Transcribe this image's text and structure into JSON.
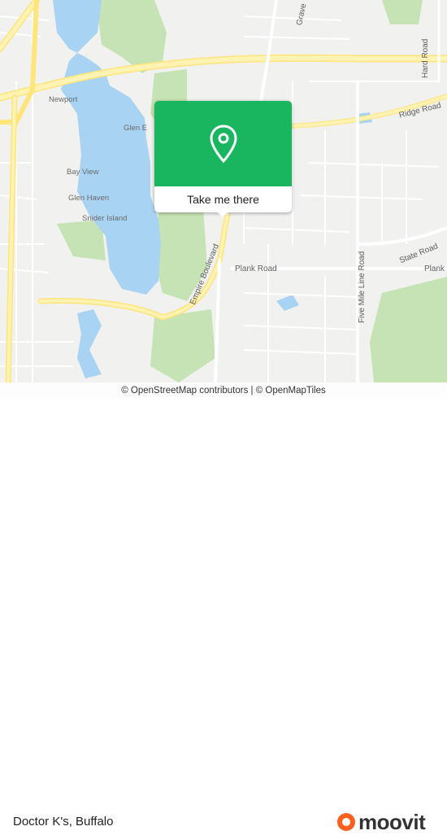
{
  "map": {
    "roads": {
      "hard_road": "Hard Road",
      "ridge_road": "Ridge Road",
      "state_road": "State Road",
      "plank_road": "Plank Road",
      "empire_boulevard": "Empire Boulevard",
      "five_mile_line_road": "Five Mile Line Road",
      "grave": "Grave"
    },
    "places": {
      "newport": "Newport",
      "glen_e": "Glen E",
      "bay_view": "Bay View",
      "glen_haven": "Glen Haven",
      "snider_island": "Snider Island"
    },
    "colors": {
      "water": "#a9d3f2",
      "park": "#c5e3b4",
      "land": "#f1f1ef",
      "major_road": "#fff3b3",
      "accent": "#1ab55f"
    }
  },
  "popup": {
    "icon": "location-pin-icon",
    "button_label": "Take me there"
  },
  "attribution": "© OpenStreetMap contributors | © OpenMapTiles",
  "footer": {
    "title": "Doctor K's, Buffalo",
    "brand": "moovit",
    "brand_icon": "moovit-logo-icon"
  }
}
